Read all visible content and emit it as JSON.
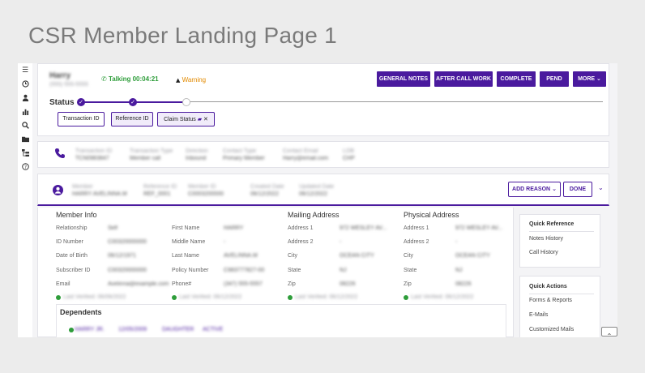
{
  "page_title": "CSR Member Landing Page 1",
  "caller": {
    "name": "Harry",
    "phone": "(555) 555-5555"
  },
  "call_status": {
    "talking": "Talking 00:04:21",
    "warning": "Warning"
  },
  "actions": [
    "GENERAL NOTES",
    "AFTER CALL WORK",
    "COMPLETE",
    "PEND",
    "MORE"
  ],
  "status": {
    "label": "Status",
    "chips": [
      "Transaction ID",
      "Reference ID",
      "Claim Status"
    ]
  },
  "transaction": {
    "fields": [
      {
        "label": "Transaction ID",
        "value": "TCN0983847"
      },
      {
        "label": "Transaction Type",
        "value": "Member call"
      },
      {
        "label": "Direction",
        "value": "Inbound"
      },
      {
        "label": "Contact Type",
        "value": "Primary Member"
      },
      {
        "label": "Contact Email",
        "value": "Harry@email.com"
      },
      {
        "label": "LOB",
        "value": "CHP"
      }
    ]
  },
  "member_bar": {
    "fields": [
      {
        "label": "Member",
        "value": "HARRY AVELINNA.M"
      },
      {
        "label": "Reference ID",
        "value": "REF_0001"
      },
      {
        "label": "Member ID",
        "value": "C0003200000"
      },
      {
        "label": "Created Date",
        "value": "06/12/2022"
      },
      {
        "label": "Updated Date",
        "value": "06/12/2022"
      }
    ],
    "add_reason": "ADD REASON",
    "done": "DONE"
  },
  "member_info": {
    "title": "Member Info",
    "rows": [
      {
        "label": "Relationship",
        "value": "Self"
      },
      {
        "label": "ID Number",
        "value": "C00320000000"
      },
      {
        "label": "Date of Birth",
        "value": "06/12/1971"
      },
      {
        "label": "Subscriber ID",
        "value": "C00320000000"
      },
      {
        "label": "Email",
        "value": "Avelinna@example.com"
      }
    ],
    "verified": "Last Verified: 06/06/2022"
  },
  "member_info2": {
    "rows": [
      {
        "label": "First Name",
        "value": "HARRY"
      },
      {
        "label": "Middle Name",
        "value": "-"
      },
      {
        "label": "Last Name",
        "value": "AVELINNA.M"
      },
      {
        "label": "Policy Number",
        "value": "C983777827-00"
      },
      {
        "label": "Phone#",
        "value": "(347) 555-5557"
      }
    ],
    "verified": "Last Verified: 06/12/2022"
  },
  "mailing": {
    "title": "Mailing Address",
    "rows": [
      {
        "label": "Address 1",
        "value": "972 WESLEY AV..."
      },
      {
        "label": "Address 2",
        "value": "-"
      },
      {
        "label": "City",
        "value": "OCEAN CITY"
      },
      {
        "label": "State",
        "value": "NJ"
      },
      {
        "label": "Zip",
        "value": "08226"
      }
    ],
    "verified": "Last Verified: 06/12/2022"
  },
  "physical": {
    "title": "Physical Address",
    "rows": [
      {
        "label": "Address 1",
        "value": "972 WESLEY AV..."
      },
      {
        "label": "Address 2",
        "value": "-"
      },
      {
        "label": "City",
        "value": "OCEAN CITY"
      },
      {
        "label": "State",
        "value": "NJ"
      },
      {
        "label": "Zip",
        "value": "08226"
      }
    ],
    "verified": "Last Verified: 06/12/2022"
  },
  "dependents": {
    "title": "Dependents",
    "row": [
      "HARRY JR.",
      "12/05/2009",
      "DAUGHTER",
      "ACTIVE"
    ]
  },
  "quick_reference": {
    "title": "Quick Reference",
    "items": [
      "Notes History",
      "Call History"
    ]
  },
  "quick_actions": {
    "title": "Quick Actions",
    "items": [
      "Forms & Reports",
      "E-Mails",
      "Customized Mails"
    ]
  },
  "colors": {
    "primary": "#4a1a9e",
    "talking": "#2e9d3a",
    "warning": "#e28a00",
    "page_bg": "#ececec"
  },
  "icons": [
    "menu-icon",
    "clock-icon",
    "person-icon",
    "bar-chart-icon",
    "search-icon",
    "folder-icon",
    "sitemap-icon",
    "help-icon",
    "phone-icon",
    "account-icon",
    "chevron-down-icon",
    "chevron-up-icon",
    "check-icon",
    "comment-icon",
    "close-icon",
    "warning-icon"
  ]
}
